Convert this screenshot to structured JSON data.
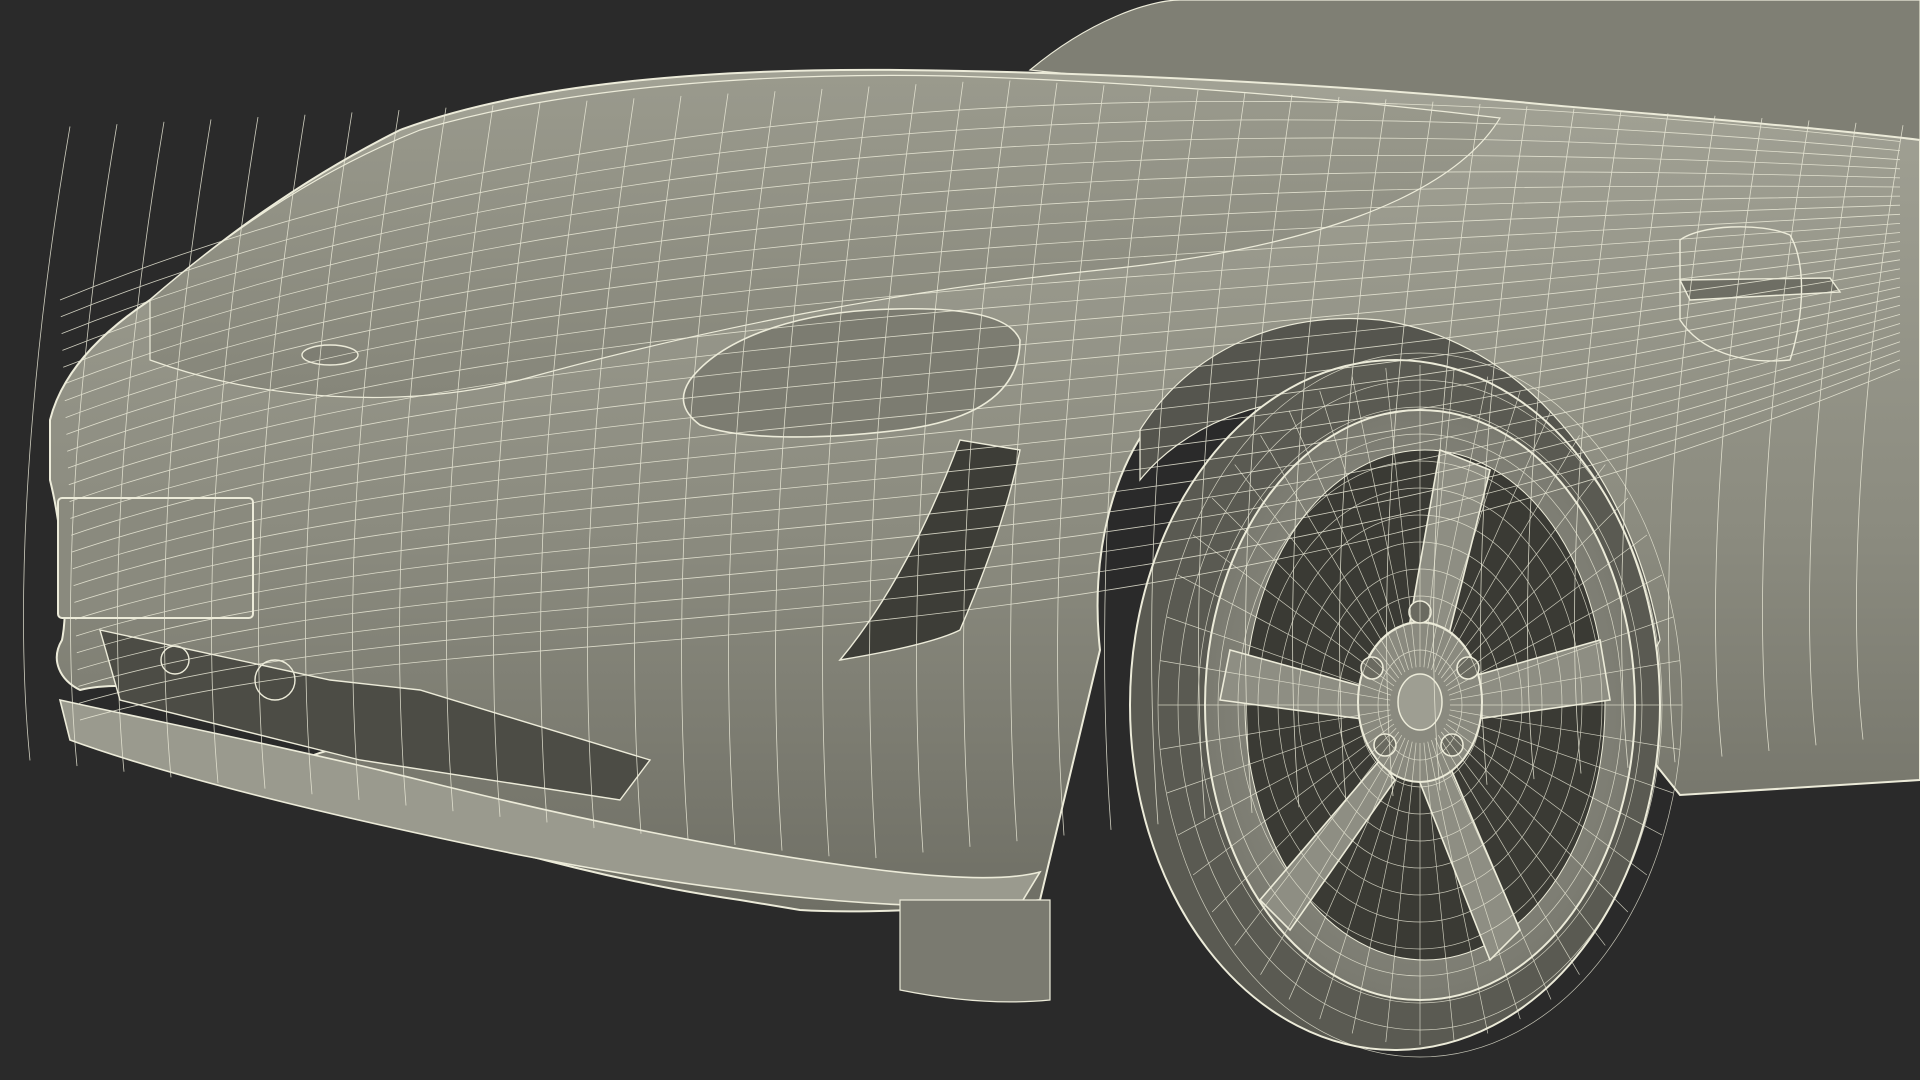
{
  "scene": {
    "subject": "sports-car-front-wireframe-render",
    "colors": {
      "background": "#2a2a2a",
      "body": "#8b8b7f",
      "body_shadow": "#6f6f65",
      "body_light": "#a2a295",
      "wire": "#ecebd9",
      "tire": "#5a5a52",
      "rim": "#8e8e83",
      "dark": "#33332f"
    }
  }
}
